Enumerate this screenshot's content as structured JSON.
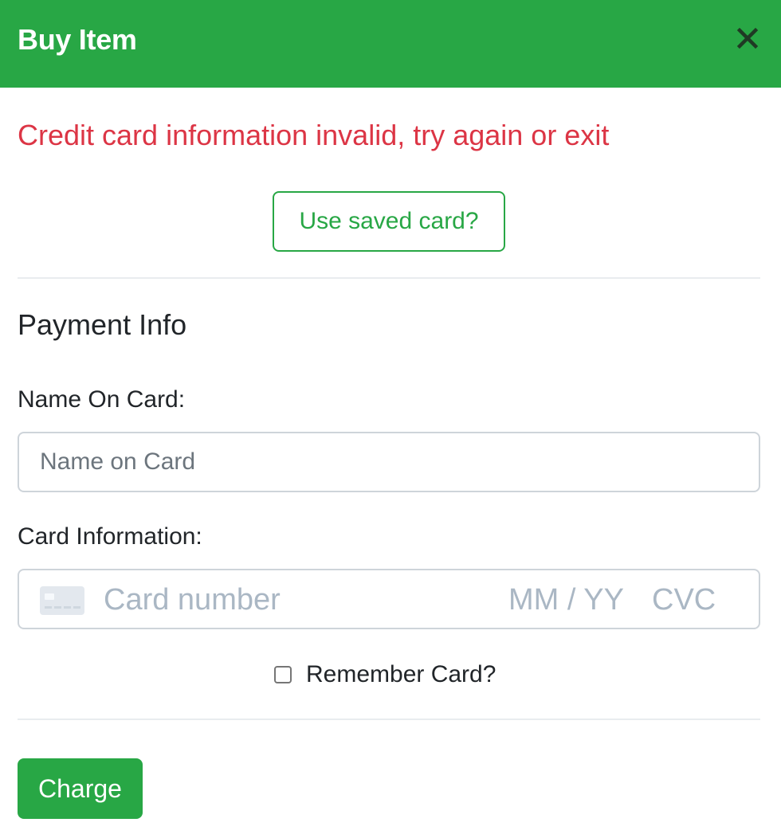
{
  "header": {
    "title": "Buy Item",
    "close_icon": "close-icon"
  },
  "error": {
    "message": "Credit card information invalid, try again or exit",
    "color": "#dc3545"
  },
  "saved_card": {
    "label": "Use saved card?"
  },
  "payment": {
    "title": "Payment Info",
    "name_label": "Name On Card:",
    "name_placeholder": "Name on Card",
    "name_value": "",
    "card_label": "Card Information:",
    "card_icon": "credit-card-icon",
    "card_number_placeholder": "Card number",
    "card_exp_placeholder": "MM / YY",
    "card_cvc_placeholder": "CVC",
    "remember_label": "Remember Card?",
    "remember_checked": false
  },
  "actions": {
    "charge_label": "Charge"
  },
  "colors": {
    "accent": "#28a745",
    "error": "#dc3545"
  }
}
